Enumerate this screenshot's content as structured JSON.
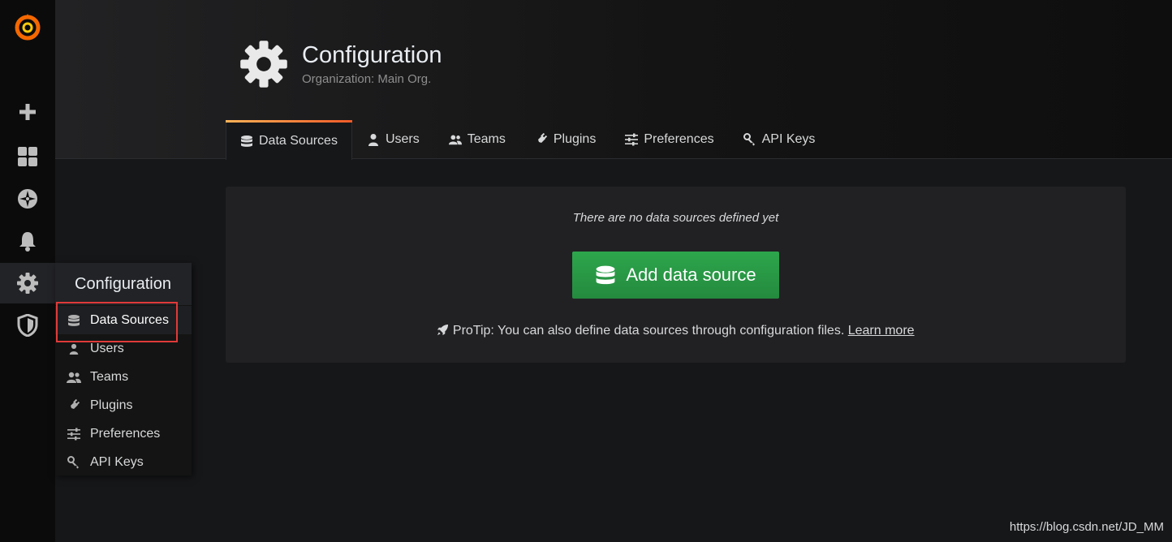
{
  "sidebar": {
    "items": [
      {
        "name": "create",
        "icon": "plus-icon"
      },
      {
        "name": "dashboards",
        "icon": "grid-icon"
      },
      {
        "name": "explore",
        "icon": "compass-icon"
      },
      {
        "name": "alerting",
        "icon": "bell-icon"
      },
      {
        "name": "configuration",
        "icon": "gear-icon"
      },
      {
        "name": "server-admin",
        "icon": "shield-icon"
      }
    ]
  },
  "header": {
    "title": "Configuration",
    "subtitle": "Organization: Main Org."
  },
  "tabs": [
    {
      "label": "Data Sources",
      "icon": "database-icon",
      "active": true
    },
    {
      "label": "Users",
      "icon": "user-icon"
    },
    {
      "label": "Teams",
      "icon": "users-icon"
    },
    {
      "label": "Plugins",
      "icon": "plug-icon"
    },
    {
      "label": "Preferences",
      "icon": "sliders-icon"
    },
    {
      "label": "API Keys",
      "icon": "key-icon"
    }
  ],
  "empty": {
    "message": "There are no data sources defined yet",
    "button": "Add data source",
    "protip": "ProTip: You can also define data sources through configuration files.",
    "protip_link": "Learn more"
  },
  "menu": {
    "title": "Configuration",
    "items": [
      {
        "label": "Data Sources",
        "icon": "database-icon"
      },
      {
        "label": "Users",
        "icon": "user-icon"
      },
      {
        "label": "Teams",
        "icon": "users-icon"
      },
      {
        "label": "Plugins",
        "icon": "plug-icon"
      },
      {
        "label": "Preferences",
        "icon": "sliders-icon"
      },
      {
        "label": "API Keys",
        "icon": "key-icon"
      }
    ]
  },
  "watermark": "https://blog.csdn.net/JD_MM",
  "colors": {
    "accent_orange": "#f05a28",
    "button_green": "#299c46",
    "highlight_red": "#e03a3a"
  }
}
